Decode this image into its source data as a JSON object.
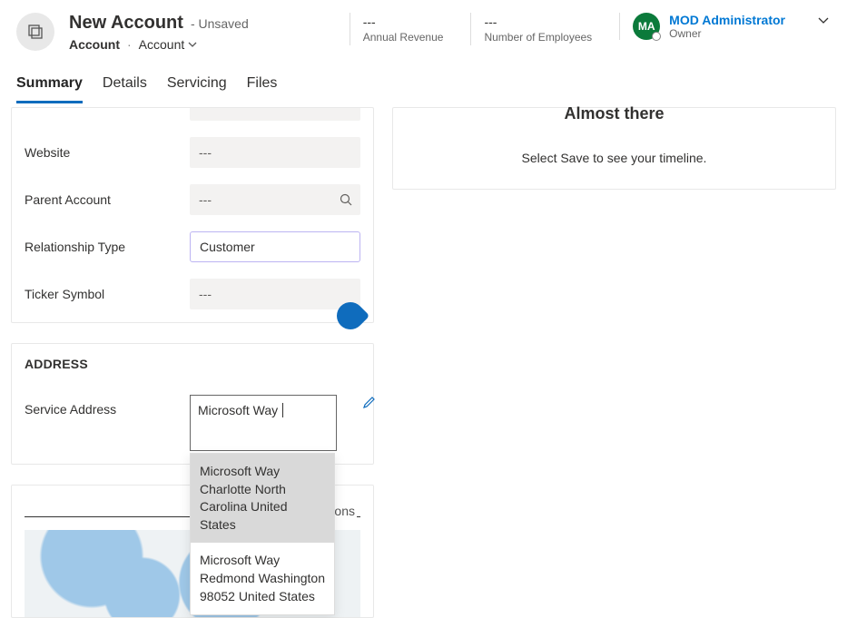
{
  "header": {
    "title": "New Account",
    "status_suffix": "- Unsaved",
    "breadcrumb_entity": "Account",
    "breadcrumb_form": "Account",
    "annual_revenue_value": "---",
    "annual_revenue_label": "Annual Revenue",
    "num_employees_value": "---",
    "num_employees_label": "Number of Employees",
    "owner_initials": "MA",
    "owner_name": "MOD Administrator",
    "owner_label": "Owner"
  },
  "tabs": {
    "summary": "Summary",
    "details": "Details",
    "servicing": "Servicing",
    "files": "Files"
  },
  "fields": {
    "website_label": "Website",
    "website_value": "---",
    "parent_account_label": "Parent Account",
    "parent_account_value": "---",
    "relationship_type_label": "Relationship Type",
    "relationship_type_value": "Customer",
    "ticker_label": "Ticker Symbol",
    "ticker_value": "---"
  },
  "address": {
    "section_title": "ADDRESS",
    "service_address_label": "Service Address",
    "service_address_value": "Microsoft Way",
    "suggestions": [
      "Microsoft Way Charlotte North Carolina United States",
      "Microsoft Way Redmond Washington 98052 United States"
    ]
  },
  "sections": {
    "label": "ctions"
  },
  "timeline": {
    "title": "Almost there",
    "subtitle": "Select Save to see your timeline."
  }
}
